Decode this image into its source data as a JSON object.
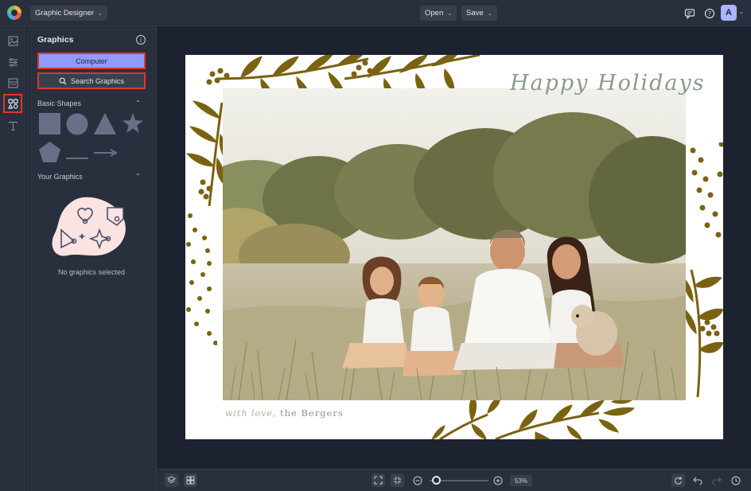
{
  "topbar": {
    "app_menu_label": "Graphic Designer",
    "open_label": "Open",
    "save_label": "Save",
    "avatar_initial": "A",
    "icons": [
      "comment-icon",
      "help-icon"
    ]
  },
  "leftrail": {
    "items": [
      {
        "name": "images-icon",
        "active": false
      },
      {
        "name": "adjustments-icon",
        "active": false
      },
      {
        "name": "layout-icon",
        "active": false
      },
      {
        "name": "graphics-icon",
        "active": true
      },
      {
        "name": "text-icon",
        "active": false
      }
    ]
  },
  "panel": {
    "title": "Graphics",
    "computer_button": "Computer",
    "search_button": "Search Graphics",
    "basic_shapes_label": "Basic Shapes",
    "shapes": [
      "square",
      "circle",
      "triangle",
      "star",
      "pentagon",
      "line",
      "arrow"
    ],
    "your_graphics_label": "Your Graphics",
    "empty_message": "No graphics selected"
  },
  "card": {
    "greeting": "Happy Holidays",
    "signature_prefix": "with love,",
    "signature_name": "the Bergers",
    "accent_color": "#7a6210"
  },
  "bottombar": {
    "zoom_label": "53%",
    "zoom_level": 0.05,
    "icons": [
      "layers-icon",
      "grid-icon",
      "fit-screen-icon",
      "actual-size-icon",
      "zoom-out-icon",
      "zoom-in-icon",
      "rotate-icon",
      "undo-icon",
      "redo-icon",
      "history-icon"
    ]
  },
  "colors": {
    "highlight": "#e0352b",
    "primary_button": "#8f9bff",
    "background": "#1d2230",
    "panel": "#2a2f3d"
  }
}
